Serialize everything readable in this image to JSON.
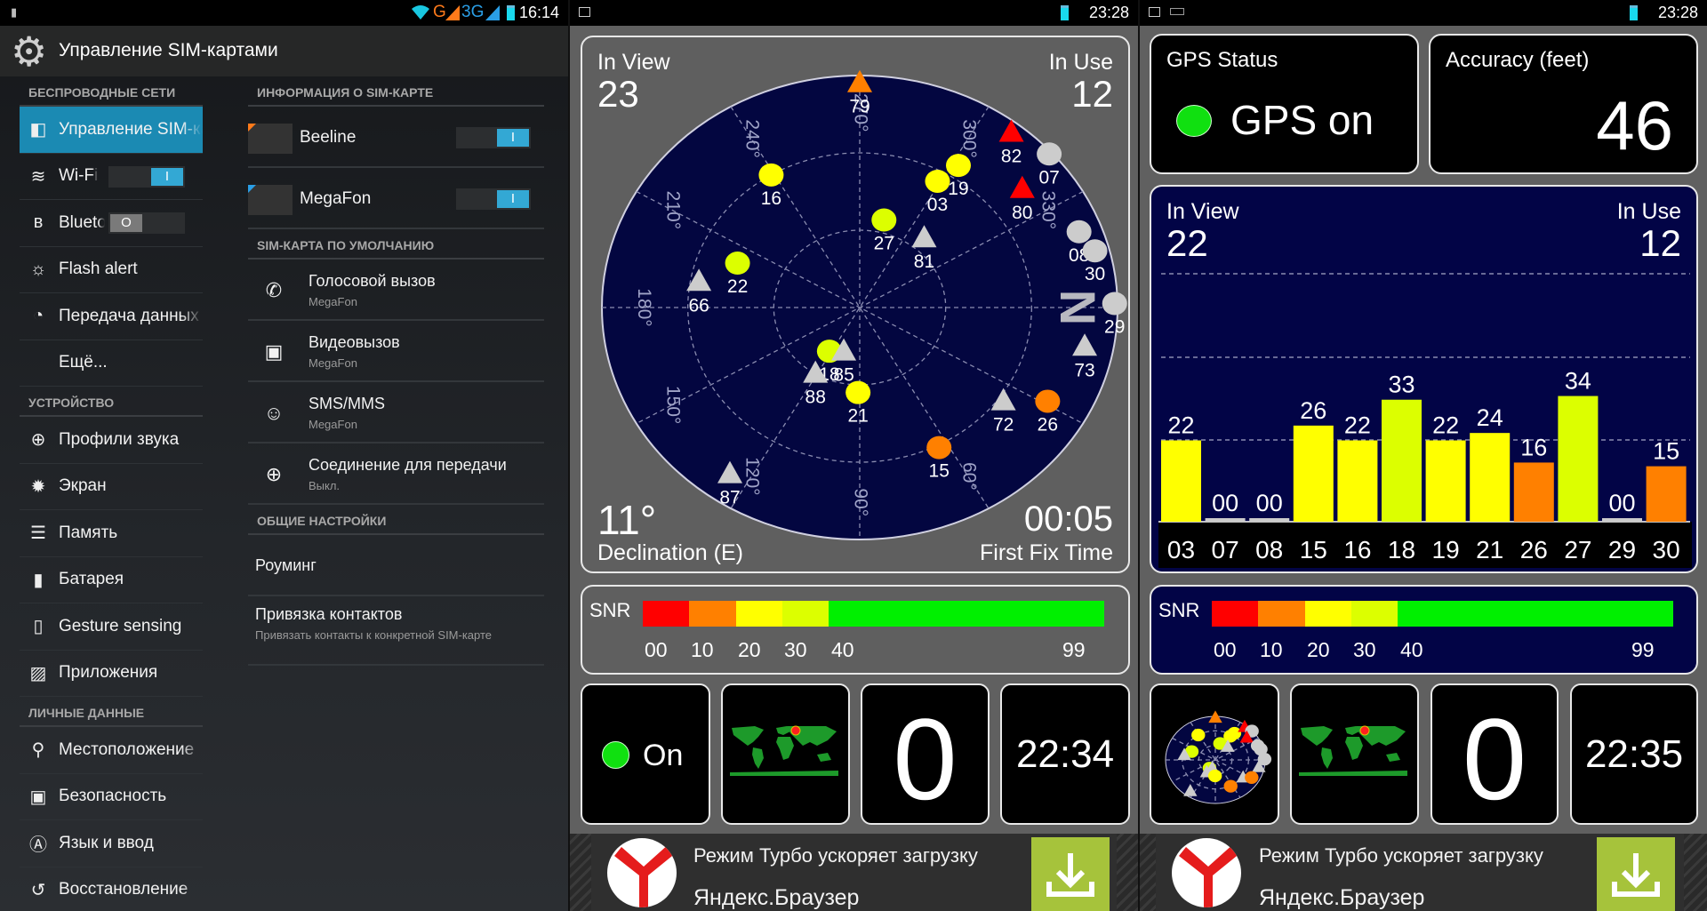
{
  "panel1": {
    "status_time": "16:14",
    "status_network_labels": [
      "G",
      "3G"
    ],
    "title": "Управление SIM-картами",
    "left_sections": [
      {
        "label": "БЕСПРОВОДНЫЕ СЕТИ",
        "items": [
          {
            "label": "Управление SIM-картами",
            "icon": "sim-card-icon",
            "selected": true
          },
          {
            "label": "Wi-Fi",
            "icon": "wifi-icon",
            "toggle": "on"
          },
          {
            "label": "Bluetooth",
            "icon": "bluetooth-icon",
            "toggle": "off"
          },
          {
            "label": "Flash alert",
            "icon": "flash-alert-icon"
          },
          {
            "label": "Передача данных",
            "icon": "data-usage-icon"
          },
          {
            "label": "Ещё...",
            "icon": ""
          }
        ]
      },
      {
        "label": "УСТРОЙСТВО",
        "items": [
          {
            "label": "Профили звука",
            "icon": "sound-profiles-icon"
          },
          {
            "label": "Экран",
            "icon": "display-icon"
          },
          {
            "label": "Память",
            "icon": "storage-icon"
          },
          {
            "label": "Батарея",
            "icon": "battery-icon"
          },
          {
            "label": "Gesture sensing",
            "icon": "phone-icon"
          },
          {
            "label": "Приложения",
            "icon": "apps-icon"
          }
        ]
      },
      {
        "label": "ЛИЧНЫЕ ДАННЫЕ",
        "items": [
          {
            "label": "Местоположение",
            "icon": "location-icon"
          },
          {
            "label": "Безопасность",
            "icon": "lock-icon"
          },
          {
            "label": "Язык и ввод",
            "icon": "language-icon"
          },
          {
            "label": "Восстановление",
            "icon": "backup-icon"
          }
        ]
      }
    ],
    "sim_info_label": "ИНФОРМАЦИЯ О SIM-КАРТЕ",
    "sims": [
      {
        "name": "Beeline",
        "color": "#ff7a1a",
        "enabled": true
      },
      {
        "name": "MegaFon",
        "color": "#2a9ee6",
        "enabled": true
      }
    ],
    "default_sim_label": "SIM-КАРТА ПО УМОЛЧАНИЮ",
    "defaults": [
      {
        "title": "Голосовой вызов",
        "value": "MegaFon",
        "icon": "phone-call-icon"
      },
      {
        "title": "Видеовызов",
        "value": "MegaFon",
        "icon": "video-call-icon"
      },
      {
        "title": "SMS/MMS",
        "value": "MegaFon",
        "icon": "sms-icon"
      },
      {
        "title": "Соединение для передачи",
        "value": "Выкл.",
        "icon": "globe-icon"
      }
    ],
    "general_label": "ОБЩИЕ НАСТРОЙКИ",
    "roaming": "Роуминг",
    "contacts_bind": {
      "title": "Привязка контактов",
      "subtitle": "Привязать контакты к конкретной SIM-карте"
    }
  },
  "panel2": {
    "status_time": "23:28",
    "in_view_label": "In View",
    "in_view": "23",
    "in_use_label": "In Use",
    "in_use": "12",
    "declination": "11°",
    "declination_label": "Declination (E)",
    "first_fix": "00:05",
    "first_fix_label": "First Fix Time",
    "north_label": "N",
    "degree_labels": [
      "60°",
      "90°",
      "120°",
      "150°",
      "180°",
      "210°",
      "240°",
      "270°",
      "300°",
      "330°"
    ],
    "tile_status": "On",
    "tile_count": "0",
    "tile_time": "22:34"
  },
  "panel3": {
    "status_time": "23:28",
    "gps_status_label": "GPS Status",
    "gps_status": "GPS on",
    "accuracy_label": "Accuracy (feet)",
    "accuracy": "46",
    "in_view_label": "In View",
    "in_view": "22",
    "in_use_label": "In Use",
    "in_use": "12",
    "tile_count": "0",
    "tile_time": "22:35"
  },
  "snr_legend": {
    "label": "SNR",
    "ticks": [
      "00",
      "10",
      "20",
      "30",
      "40",
      "99"
    ],
    "colors": [
      "#ff0000",
      "#ff8000",
      "#ffff00",
      "#dcff00",
      "#00f000"
    ]
  },
  "ad": {
    "line1": "Режим Турбо ускоряет загрузку",
    "line2": "Яндекс.Браузер"
  },
  "chart_data": [
    {
      "type": "bar",
      "categories": [
        "03",
        "07",
        "08",
        "15",
        "16",
        "18",
        "19",
        "21",
        "26",
        "27",
        "29",
        "30"
      ],
      "values": [
        22,
        0,
        0,
        26,
        22,
        33,
        22,
        24,
        16,
        34,
        0,
        15
      ],
      "value_labels": [
        "22",
        "00",
        "00",
        "26",
        "22",
        "33",
        "22",
        "24",
        "16",
        "34",
        "00",
        "15"
      ],
      "colors": [
        "#ffff00",
        "#cccccc",
        "#cccccc",
        "#ffff00",
        "#ffff00",
        "#dcff00",
        "#ffff00",
        "#ffff00",
        "#ff8000",
        "#dcff00",
        "#cccccc",
        "#ff8000"
      ],
      "grid": true
    },
    {
      "type": "scatter",
      "coordinate_system": "polar (azimuth °, elevation °)",
      "points": [
        {
          "prn": "79",
          "az": 270,
          "el": 3,
          "shape": "triangle",
          "color": "#ff8000"
        },
        {
          "prn": "16",
          "az": 239,
          "el": 30,
          "shape": "circle",
          "color": "#ffff00"
        },
        {
          "prn": "03",
          "az": 299,
          "el": 34,
          "shape": "circle",
          "color": "#ffff00"
        },
        {
          "prn": "19",
          "az": 302,
          "el": 25,
          "shape": "circle",
          "color": "#ffff00"
        },
        {
          "prn": "82",
          "az": 308,
          "el": 4,
          "shape": "triangle",
          "color": "#ff0000"
        },
        {
          "prn": "07",
          "az": 318,
          "el": 1,
          "shape": "circle",
          "color": "#cccccc"
        },
        {
          "prn": "80",
          "az": 321,
          "el": 17,
          "shape": "triangle",
          "color": "#ff0000"
        },
        {
          "prn": "27",
          "az": 284,
          "el": 55,
          "shape": "circle",
          "color": "#dcff00"
        },
        {
          "prn": "81",
          "az": 310,
          "el": 55,
          "shape": "triangle",
          "color": "#cccccc"
        },
        {
          "prn": "08",
          "az": 339,
          "el": 8,
          "shape": "circle",
          "color": "#cccccc"
        },
        {
          "prn": "30",
          "az": 345,
          "el": 5,
          "shape": "circle",
          "color": "#cccccc"
        },
        {
          "prn": "29",
          "az": 359,
          "el": 1,
          "shape": "circle",
          "color": "#cccccc"
        },
        {
          "prn": "22",
          "az": 202,
          "el": 44,
          "shape": "circle",
          "color": "#dcff00"
        },
        {
          "prn": "66",
          "az": 190,
          "el": 33,
          "shape": "triangle",
          "color": "#cccccc"
        },
        {
          "prn": "73",
          "az": 11,
          "el": 10,
          "shape": "triangle",
          "color": "#cccccc"
        },
        {
          "prn": "18",
          "az": 122,
          "el": 70,
          "shape": "circle",
          "color": "#dcff00"
        },
        {
          "prn": "85",
          "az": 108,
          "el": 72,
          "shape": "triangle",
          "color": "#cccccc"
        },
        {
          "prn": "88",
          "az": 121,
          "el": 60,
          "shape": "triangle",
          "color": "#cccccc"
        },
        {
          "prn": "21",
          "az": 91,
          "el": 57,
          "shape": "circle",
          "color": "#ffff00"
        },
        {
          "prn": "72",
          "az": 36,
          "el": 28,
          "shape": "triangle",
          "color": "#cccccc"
        },
        {
          "prn": "26",
          "az": 29,
          "el": 15,
          "shape": "circle",
          "color": "#ff8000"
        },
        {
          "prn": "15",
          "az": 63,
          "el": 29,
          "shape": "circle",
          "color": "#ff8000"
        },
        {
          "prn": "87",
          "az": 125,
          "el": 11,
          "shape": "triangle",
          "color": "#cccccc"
        }
      ]
    }
  ]
}
